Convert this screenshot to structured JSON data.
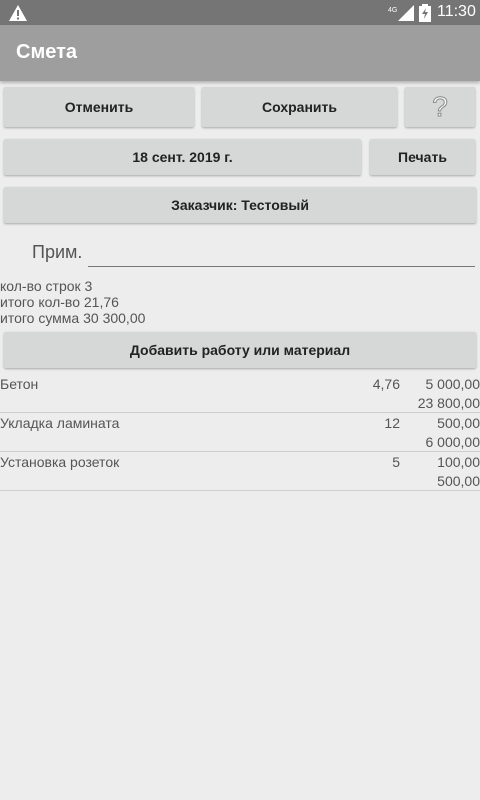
{
  "status": {
    "time": "11:30",
    "network": "4G",
    "icons": [
      "warning-icon",
      "signal-icon",
      "battery-icon"
    ]
  },
  "appbar": {
    "title": "Смета"
  },
  "toolbar": {
    "cancel": "Отменить",
    "save": "Сохранить",
    "help": "?"
  },
  "date": "18 сент. 2019 г.",
  "print": "Печать",
  "customer": "Заказчик: Тестовый",
  "note": {
    "label": "Прим.",
    "value": ""
  },
  "summary": {
    "rows": "кол-во строк 3",
    "qty": "итого кол-во 21,76",
    "sum": "итого сумма 30 300,00"
  },
  "add_button": "Добавить работу или материал",
  "items": [
    {
      "name": "Бетон",
      "qty": "4,76",
      "price": "5 000,00",
      "total": "23 800,00"
    },
    {
      "name": "Укладка ламината",
      "qty": "12",
      "price": "500,00",
      "total": "6 000,00"
    },
    {
      "name": "Установка розеток",
      "qty": "5",
      "price": "100,00",
      "total": "500,00"
    }
  ],
  "colors": {
    "appbar": "#9e9e9e",
    "statusbar": "#757575",
    "background": "#ededed",
    "button": "#d6d7d7"
  }
}
